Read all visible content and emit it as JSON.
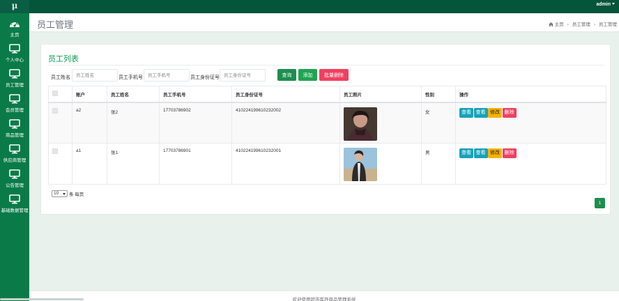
{
  "topbar": {
    "logo": "μ",
    "user": "admin"
  },
  "sidebar": {
    "items": [
      {
        "label": "主页",
        "icon": "dashboard-icon"
      },
      {
        "label": "个人中心",
        "icon": "monitor-icon"
      },
      {
        "label": "员工管理",
        "icon": "monitor-icon"
      },
      {
        "label": "会员管理",
        "icon": "monitor-icon"
      },
      {
        "label": "商品管理",
        "icon": "monitor-icon"
      },
      {
        "label": "供应商管理",
        "icon": "monitor-icon"
      },
      {
        "label": "公告管理",
        "icon": "monitor-icon"
      },
      {
        "label": "基础数据管理",
        "icon": "monitor-icon"
      }
    ]
  },
  "header": {
    "title": "员工管理",
    "breadcrumb": [
      "主页",
      "员工管理",
      "员工管理"
    ]
  },
  "card": {
    "title": "员工列表",
    "filters": {
      "name_label": "员工姓名",
      "name_placeholder": "员工姓名",
      "phone_label": "员工手机号",
      "phone_placeholder": "员工手机号",
      "idcard_label": "员工身份证号",
      "idcard_placeholder": "员工身份证号"
    },
    "buttons": {
      "query": "查询",
      "add": "添加",
      "batch_delete": "批量删除"
    },
    "columns": [
      "",
      "账户",
      "员工姓名",
      "员工手机号",
      "员工身份证号",
      "员工照片",
      "性别",
      "操作"
    ],
    "rows": [
      {
        "account": "a2",
        "name": "张2",
        "phone": "17703786902",
        "idcard": "410224199610232002",
        "gender": "女"
      },
      {
        "account": "a1",
        "name": "张1",
        "phone": "17703786901",
        "idcard": "410224199610232001",
        "gender": "男"
      }
    ],
    "row_actions": {
      "view": "查看",
      "edit": "修改",
      "delete": "删除"
    },
    "pager": {
      "page_size": "10",
      "per_page_label": "条 每页",
      "current_page": "1"
    }
  },
  "footer": {
    "text": "欢迎使用超市库存商品管理系统"
  },
  "colors": {
    "topbar": "#04553a",
    "sidebar": "#0a7b48",
    "accent": "#0f9d58",
    "danger": "#f0405f",
    "info": "#17a2b8",
    "warning": "#f5b301"
  }
}
